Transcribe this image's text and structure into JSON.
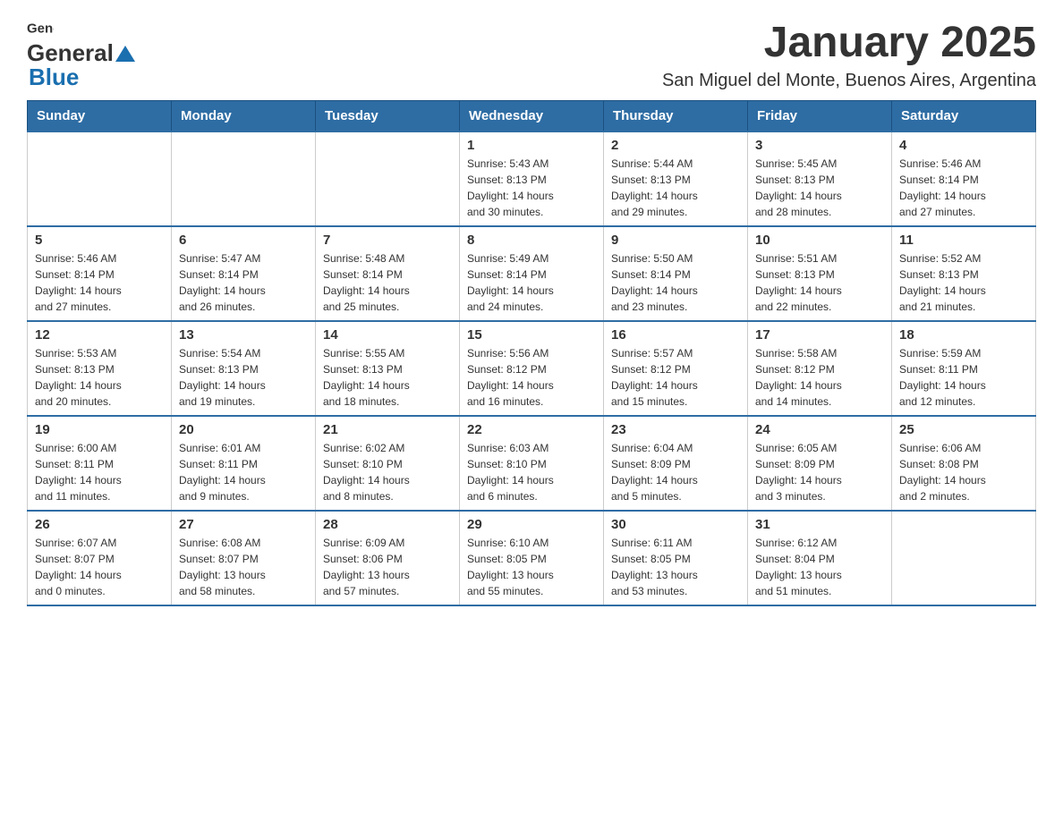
{
  "header": {
    "logo_general": "General",
    "logo_blue": "Blue",
    "title": "January 2025",
    "subtitle": "San Miguel del Monte, Buenos Aires, Argentina"
  },
  "days_of_week": [
    "Sunday",
    "Monday",
    "Tuesday",
    "Wednesday",
    "Thursday",
    "Friday",
    "Saturday"
  ],
  "weeks": [
    [
      {
        "day": "",
        "info": ""
      },
      {
        "day": "",
        "info": ""
      },
      {
        "day": "",
        "info": ""
      },
      {
        "day": "1",
        "info": "Sunrise: 5:43 AM\nSunset: 8:13 PM\nDaylight: 14 hours\nand 30 minutes."
      },
      {
        "day": "2",
        "info": "Sunrise: 5:44 AM\nSunset: 8:13 PM\nDaylight: 14 hours\nand 29 minutes."
      },
      {
        "day": "3",
        "info": "Sunrise: 5:45 AM\nSunset: 8:13 PM\nDaylight: 14 hours\nand 28 minutes."
      },
      {
        "day": "4",
        "info": "Sunrise: 5:46 AM\nSunset: 8:14 PM\nDaylight: 14 hours\nand 27 minutes."
      }
    ],
    [
      {
        "day": "5",
        "info": "Sunrise: 5:46 AM\nSunset: 8:14 PM\nDaylight: 14 hours\nand 27 minutes."
      },
      {
        "day": "6",
        "info": "Sunrise: 5:47 AM\nSunset: 8:14 PM\nDaylight: 14 hours\nand 26 minutes."
      },
      {
        "day": "7",
        "info": "Sunrise: 5:48 AM\nSunset: 8:14 PM\nDaylight: 14 hours\nand 25 minutes."
      },
      {
        "day": "8",
        "info": "Sunrise: 5:49 AM\nSunset: 8:14 PM\nDaylight: 14 hours\nand 24 minutes."
      },
      {
        "day": "9",
        "info": "Sunrise: 5:50 AM\nSunset: 8:14 PM\nDaylight: 14 hours\nand 23 minutes."
      },
      {
        "day": "10",
        "info": "Sunrise: 5:51 AM\nSunset: 8:13 PM\nDaylight: 14 hours\nand 22 minutes."
      },
      {
        "day": "11",
        "info": "Sunrise: 5:52 AM\nSunset: 8:13 PM\nDaylight: 14 hours\nand 21 minutes."
      }
    ],
    [
      {
        "day": "12",
        "info": "Sunrise: 5:53 AM\nSunset: 8:13 PM\nDaylight: 14 hours\nand 20 minutes."
      },
      {
        "day": "13",
        "info": "Sunrise: 5:54 AM\nSunset: 8:13 PM\nDaylight: 14 hours\nand 19 minutes."
      },
      {
        "day": "14",
        "info": "Sunrise: 5:55 AM\nSunset: 8:13 PM\nDaylight: 14 hours\nand 18 minutes."
      },
      {
        "day": "15",
        "info": "Sunrise: 5:56 AM\nSunset: 8:12 PM\nDaylight: 14 hours\nand 16 minutes."
      },
      {
        "day": "16",
        "info": "Sunrise: 5:57 AM\nSunset: 8:12 PM\nDaylight: 14 hours\nand 15 minutes."
      },
      {
        "day": "17",
        "info": "Sunrise: 5:58 AM\nSunset: 8:12 PM\nDaylight: 14 hours\nand 14 minutes."
      },
      {
        "day": "18",
        "info": "Sunrise: 5:59 AM\nSunset: 8:11 PM\nDaylight: 14 hours\nand 12 minutes."
      }
    ],
    [
      {
        "day": "19",
        "info": "Sunrise: 6:00 AM\nSunset: 8:11 PM\nDaylight: 14 hours\nand 11 minutes."
      },
      {
        "day": "20",
        "info": "Sunrise: 6:01 AM\nSunset: 8:11 PM\nDaylight: 14 hours\nand 9 minutes."
      },
      {
        "day": "21",
        "info": "Sunrise: 6:02 AM\nSunset: 8:10 PM\nDaylight: 14 hours\nand 8 minutes."
      },
      {
        "day": "22",
        "info": "Sunrise: 6:03 AM\nSunset: 8:10 PM\nDaylight: 14 hours\nand 6 minutes."
      },
      {
        "day": "23",
        "info": "Sunrise: 6:04 AM\nSunset: 8:09 PM\nDaylight: 14 hours\nand 5 minutes."
      },
      {
        "day": "24",
        "info": "Sunrise: 6:05 AM\nSunset: 8:09 PM\nDaylight: 14 hours\nand 3 minutes."
      },
      {
        "day": "25",
        "info": "Sunrise: 6:06 AM\nSunset: 8:08 PM\nDaylight: 14 hours\nand 2 minutes."
      }
    ],
    [
      {
        "day": "26",
        "info": "Sunrise: 6:07 AM\nSunset: 8:07 PM\nDaylight: 14 hours\nand 0 minutes."
      },
      {
        "day": "27",
        "info": "Sunrise: 6:08 AM\nSunset: 8:07 PM\nDaylight: 13 hours\nand 58 minutes."
      },
      {
        "day": "28",
        "info": "Sunrise: 6:09 AM\nSunset: 8:06 PM\nDaylight: 13 hours\nand 57 minutes."
      },
      {
        "day": "29",
        "info": "Sunrise: 6:10 AM\nSunset: 8:05 PM\nDaylight: 13 hours\nand 55 minutes."
      },
      {
        "day": "30",
        "info": "Sunrise: 6:11 AM\nSunset: 8:05 PM\nDaylight: 13 hours\nand 53 minutes."
      },
      {
        "day": "31",
        "info": "Sunrise: 6:12 AM\nSunset: 8:04 PM\nDaylight: 13 hours\nand 51 minutes."
      },
      {
        "day": "",
        "info": ""
      }
    ]
  ]
}
